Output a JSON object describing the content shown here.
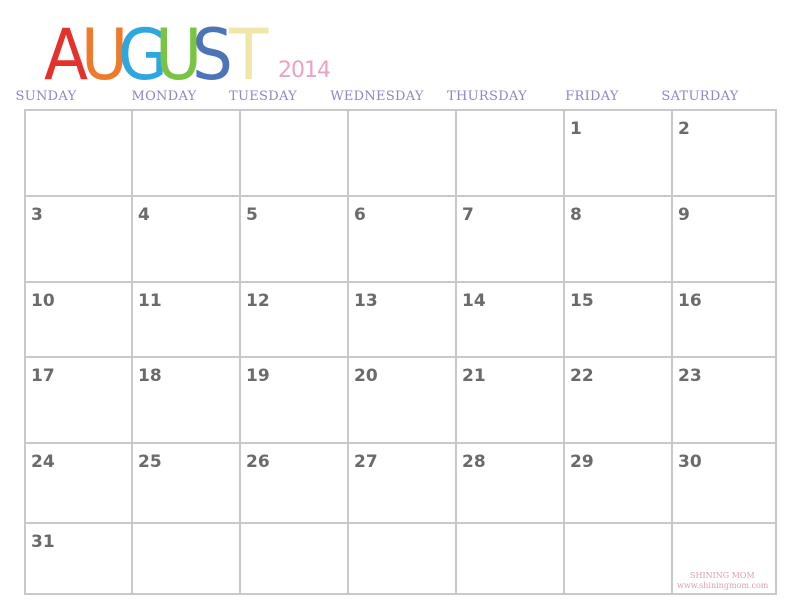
{
  "header": {
    "month_letters": [
      {
        "ch": "A",
        "color": "#e5312b"
      },
      {
        "ch": "U",
        "color": "#f07a2c"
      },
      {
        "ch": "G",
        "color": "#2ea6df"
      },
      {
        "ch": "U",
        "color": "#79c443"
      },
      {
        "ch": "S",
        "color": "#4d73b8"
      },
      {
        "ch": "T",
        "color": "#efe6a8"
      }
    ],
    "year": "2014"
  },
  "weekdays": [
    "SUNDAY",
    "MONDAY",
    "TUESDAY",
    "WEDNESDAY",
    "THURSDAY",
    "FRIDAY",
    "SATURDAY"
  ],
  "weeks": [
    [
      "",
      "",
      "",
      "",
      "",
      "1",
      "2"
    ],
    [
      "3",
      "4",
      "5",
      "6",
      "7",
      "8",
      "9"
    ],
    [
      "10",
      "11",
      "12",
      "13",
      "14",
      "15",
      "16"
    ],
    [
      "17",
      "18",
      "19",
      "20",
      "21",
      "22",
      "23"
    ],
    [
      "24",
      "25",
      "26",
      "27",
      "28",
      "29",
      "30"
    ],
    [
      "31",
      "",
      "",
      "",
      "",
      "",
      ""
    ]
  ],
  "footer": {
    "brand": "SHINING MOM",
    "url": "www.shiningmom.com"
  },
  "colors": {
    "grid": "#c9c9c9",
    "weekday_text": "#8f84c6",
    "day_number": "#6b6b6b",
    "year": "#e8a2c4",
    "credit": "#d8a0b8"
  }
}
